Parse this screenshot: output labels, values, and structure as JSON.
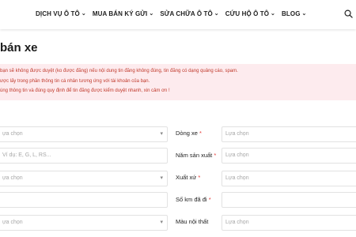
{
  "nav": {
    "items": [
      {
        "label": "DỊCH VỤ Ô TÔ",
        "chevron": "⌄"
      },
      {
        "label": "MUA BÁN KÝ GỬI",
        "chevron": "⌄"
      },
      {
        "label": "SỬA CHỮA Ô TÔ",
        "chevron": "⌄"
      },
      {
        "label": "CỨU HỘ Ô TÔ",
        "chevron": "⌄"
      },
      {
        "label": "BLOG",
        "chevron": "⌄"
      }
    ],
    "search_icon": "search-icon"
  },
  "page_title": "bán xe",
  "notice": {
    "color": "#c0392b",
    "background": "#fdebee",
    "lines": [
      "bạn sẽ không được duyệt (ko được đăng) nếu nội dung tin đăng không đúng, tin đăng có dạng quảng cáo, spam.",
      "ược lấy trong phần thông tin cá nhân tương ứng với tài khoản của bạn.",
      "úng thông tin và đúng quy định để tin đăng được kiểm duyệt nhanh, xin cảm ơn !"
    ]
  },
  "form": {
    "left_fields": [
      {
        "placeholder": "ựa chọn",
        "has_dropdown": true
      },
      {
        "placeholder": "Ví dụ: E, G, L, RS...",
        "has_dropdown": false
      },
      {
        "placeholder": "ựa chọn",
        "has_dropdown": true
      },
      {
        "placeholder": "",
        "has_dropdown": false
      },
      {
        "placeholder": "ựa chọn",
        "has_dropdown": true
      }
    ],
    "right_fields": [
      {
        "label": "Dòng xe",
        "required": "*",
        "placeholder": "Lựa chọn"
      },
      {
        "label": "Năm sản xuất",
        "required": "*",
        "placeholder": "Lựa chọn"
      },
      {
        "label": "Xuất xứ",
        "required": "*",
        "placeholder": "Lựa chọn"
      },
      {
        "label": "Số km đã đi",
        "required": "*",
        "placeholder": ""
      },
      {
        "label": "Màu nội thất",
        "required": "",
        "placeholder": "Lựa chọn"
      }
    ],
    "dropdown_glyph": "▾",
    "required_color": "#e53935"
  }
}
